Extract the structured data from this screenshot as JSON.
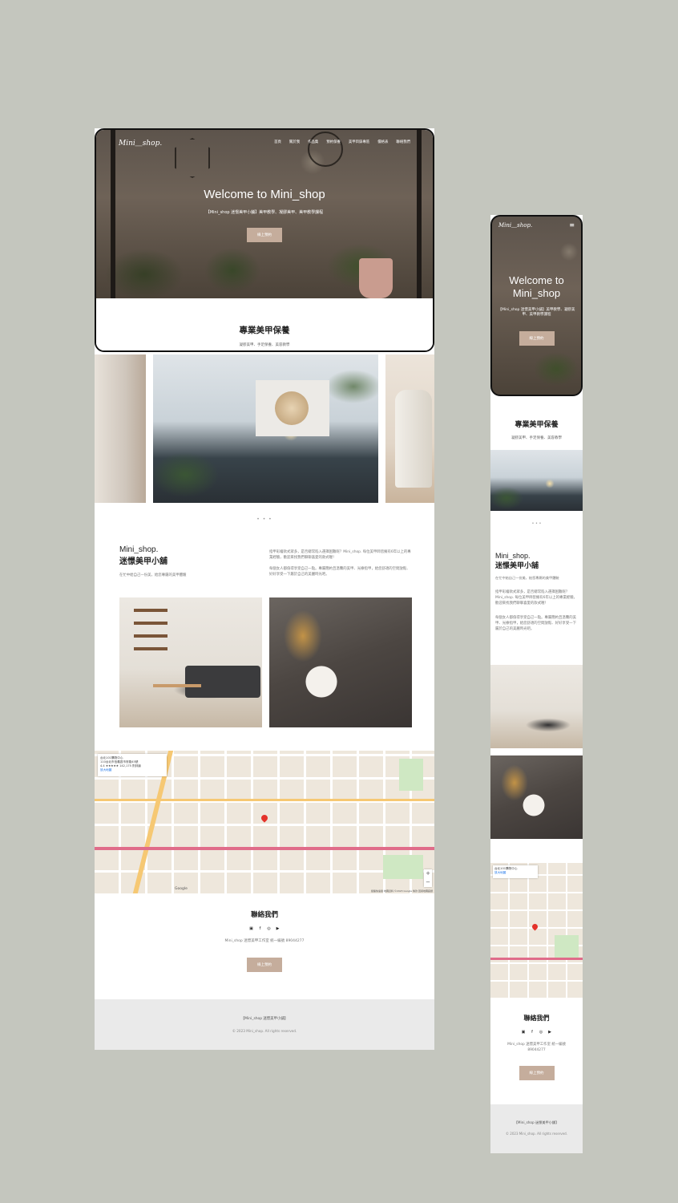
{
  "brand": {
    "logo": "Mini＿shop.",
    "name_en": "Mini_shop.",
    "name_cn": "迷憬美甲小舖"
  },
  "nav": [
    "首頁",
    "關於我",
    "作品集",
    "預約保養",
    "美甲目錄專區",
    "價格表",
    "聯絡我們"
  ],
  "hero": {
    "title": "Welcome to Mini_shop",
    "subtitle": "【Mini_shop 迷憬美甲小舖】美甲教學、凝膠美甲、美甲教學課程",
    "button": "線上預約"
  },
  "mobile_hero": {
    "title": "Welcome to Mini_shop",
    "subtitle": "【Mini_shop 迷憬美甲小舖】美甲教學、凝膠美甲、美甲教學課程",
    "button": "線上預約"
  },
  "service": {
    "title": "專業美甲保養",
    "subtitle": "凝膠美甲、手足保養、美容教學"
  },
  "carousel": {
    "dots": "• • •",
    "active_index": 0,
    "count": 3
  },
  "about": {
    "tagline": "在忙中給自己一份美，給您專屬的美甲體驗",
    "paragraph1": "指甲彩繪款式眾多，是否總常陷入選擇困難呢？Mini_shop. 每位美甲師皆擁有6年以上的專業經驗，歡迎來找我們聊聊喜愛的款式喔！",
    "paragraph2": "每個女人都值得享受自己一點。專屬簡約且溫馨的美甲、光療指甲，給您舒適的空間放鬆、好好享受一下屬於自己的美麗時光吧。"
  },
  "map": {
    "place_name": "台北101購物中心",
    "place_address": "110台北市信義區市府路45號",
    "rating": "4.4 ★★★★★ 142,175 則評論",
    "directions": "路線",
    "larger_map": "放大地圖",
    "google": "Google",
    "copyright": "鍵盤快速鍵 地圖資料 ©2023 Google 條款 回報地圖錯誤",
    "zoom_in": "+",
    "zoom_out": "−"
  },
  "contact": {
    "title": "聯絡我們",
    "address": "Mini_shop 迷憬美甲工作室 統一編號 89044277",
    "button": "線上預約"
  },
  "socials": [
    "line-icon",
    "facebook-icon",
    "instagram-icon",
    "youtube-icon"
  ],
  "footer": {
    "line1": "【Mini_shop 迷憬美甲小舖】",
    "line2": "© 2023 Mini_shop. All rights reserved."
  },
  "colors": {
    "background": "#c4c6be",
    "accent_button": "#c5ad9c",
    "footer_bg": "#eaeaea"
  }
}
